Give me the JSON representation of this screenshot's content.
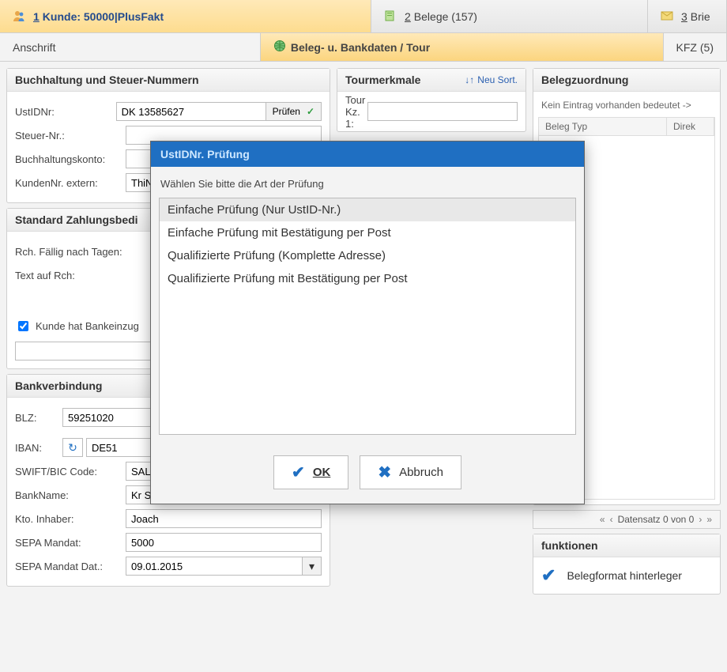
{
  "topTabs": {
    "kunde": {
      "mn": "1",
      "label": "Kunde: 50000|PlusFakt"
    },
    "belege": {
      "mn": "2",
      "label": "Belege (157)"
    },
    "brief": {
      "mn": "3",
      "label": "Brie"
    }
  },
  "subTabs": {
    "anschrift": "Anschrift",
    "belegbank": "Beleg- u. Bankdaten / Tour",
    "kfz": "KFZ (5)"
  },
  "accounting": {
    "header": "Buchhaltung und Steuer-Nummern",
    "ustid_label": "UstIDNr:",
    "ustid_value": "DK 13585627",
    "check_btn": "Prüfen",
    "taxnr_label": "Steuer-Nr.:",
    "taxnr_value": "",
    "ledger_label": "Buchhaltungskonto:",
    "ledger_value": "",
    "extcust_label": "KundenNr. extern:",
    "extcust_value": "ThiN"
  },
  "payment": {
    "header": "Standard Zahlungsbedi",
    "due_label": "Rch. Fällig nach Tagen:",
    "text_label": "Text auf Rch:",
    "einzug_label": "Kunde hat Bankeinzug"
  },
  "bank": {
    "header": "Bankverbindung",
    "blz_label": "BLZ:",
    "blz_value": "59251020",
    "iban_label": "IBAN:",
    "iban_value": "DE51",
    "bic_label": "SWIFT/BIC Code:",
    "bic_value": "SALA",
    "bankname_label": "BankName:",
    "bankname_value": "Kr Sp",
    "holder_label": "Kto. Inhaber:",
    "holder_value": "Joach",
    "mandat_label": "SEPA Mandat:",
    "mandat_value": "5000",
    "mandatdate_label": "SEPA Mandat Dat.:",
    "mandatdate_value": "09.01.2015"
  },
  "tour": {
    "header": "Tourmerkmale",
    "sort_label": "Neu Sort.",
    "kz1_label": "Tour Kz. 1:"
  },
  "assign": {
    "header": "Belegzuordnung",
    "hint": "Kein Eintrag vorhanden bedeutet ->",
    "col_type": "Beleg Typ",
    "col_direct": "Direk",
    "pager": "Datensatz 0 von 0"
  },
  "functions": {
    "header": "funktionen",
    "format_label": "Belegformat hinterleger"
  },
  "dialog": {
    "title": "UstIDNr. Prüfung",
    "instruction": "Wählen Sie bitte die Art der Prüfung",
    "options": [
      "Einfache Prüfung (Nur UstID-Nr.)",
      "Einfache Prüfung mit Bestätigung per Post",
      "Qualifizierte Prüfung (Komplette Adresse)",
      "Qualifizierte Prüfung mit Bestätigung per Post"
    ],
    "ok": "OK",
    "cancel": "Abbruch"
  }
}
